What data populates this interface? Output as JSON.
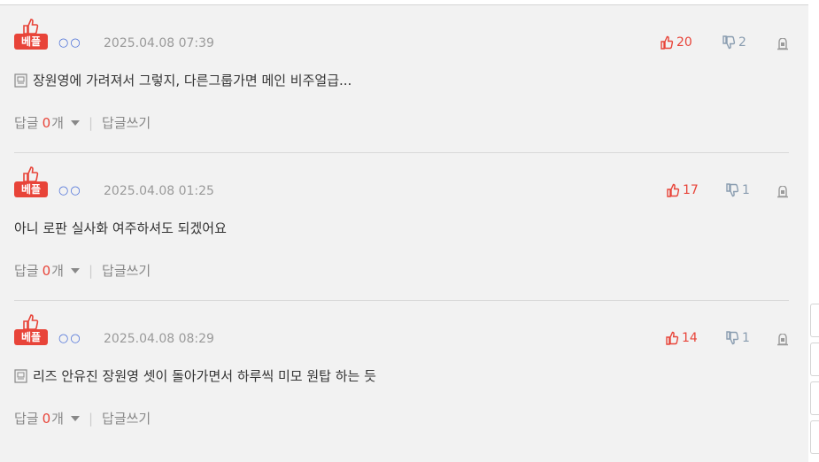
{
  "comments": [
    {
      "badge": "베플",
      "nickname": "○○",
      "date": "2025.04.08 07:39",
      "upvotes": "20",
      "downvotes": "2",
      "has_doc_icon": true,
      "text": "장원영에 가려져서 그렇지, 다른그룹가면 메인 비주얼급...",
      "reply_label": "답글",
      "reply_count": "0",
      "reply_suffix": "개",
      "write_reply": "답글쓰기"
    },
    {
      "badge": "베플",
      "nickname": "○○",
      "date": "2025.04.08 01:25",
      "upvotes": "17",
      "downvotes": "1",
      "has_doc_icon": false,
      "text": "아니 로판 실사화 여주하셔도 되겠어요",
      "reply_label": "답글",
      "reply_count": "0",
      "reply_suffix": "개",
      "write_reply": "답글쓰기"
    },
    {
      "badge": "베플",
      "nickname": "○○",
      "date": "2025.04.08 08:29",
      "upvotes": "14",
      "downvotes": "1",
      "has_doc_icon": true,
      "text": "리즈 안유진 장원영 셋이 돌아가면서 하루씩 미모 원탑 하는 듯",
      "reply_label": "답글",
      "reply_count": "0",
      "reply_suffix": "개",
      "write_reply": "답글쓰기"
    }
  ],
  "icons": {
    "thumb_up": "thumb-up-icon",
    "thumb_down": "thumb-down-icon",
    "report": "report-icon",
    "doc": "document-icon",
    "caret": "caret-down-icon"
  },
  "colors": {
    "accent_red": "#e84439",
    "nick_blue": "#4a6fd8",
    "down_gray": "#8a9db0",
    "panel_bg": "#f2f2f2"
  }
}
